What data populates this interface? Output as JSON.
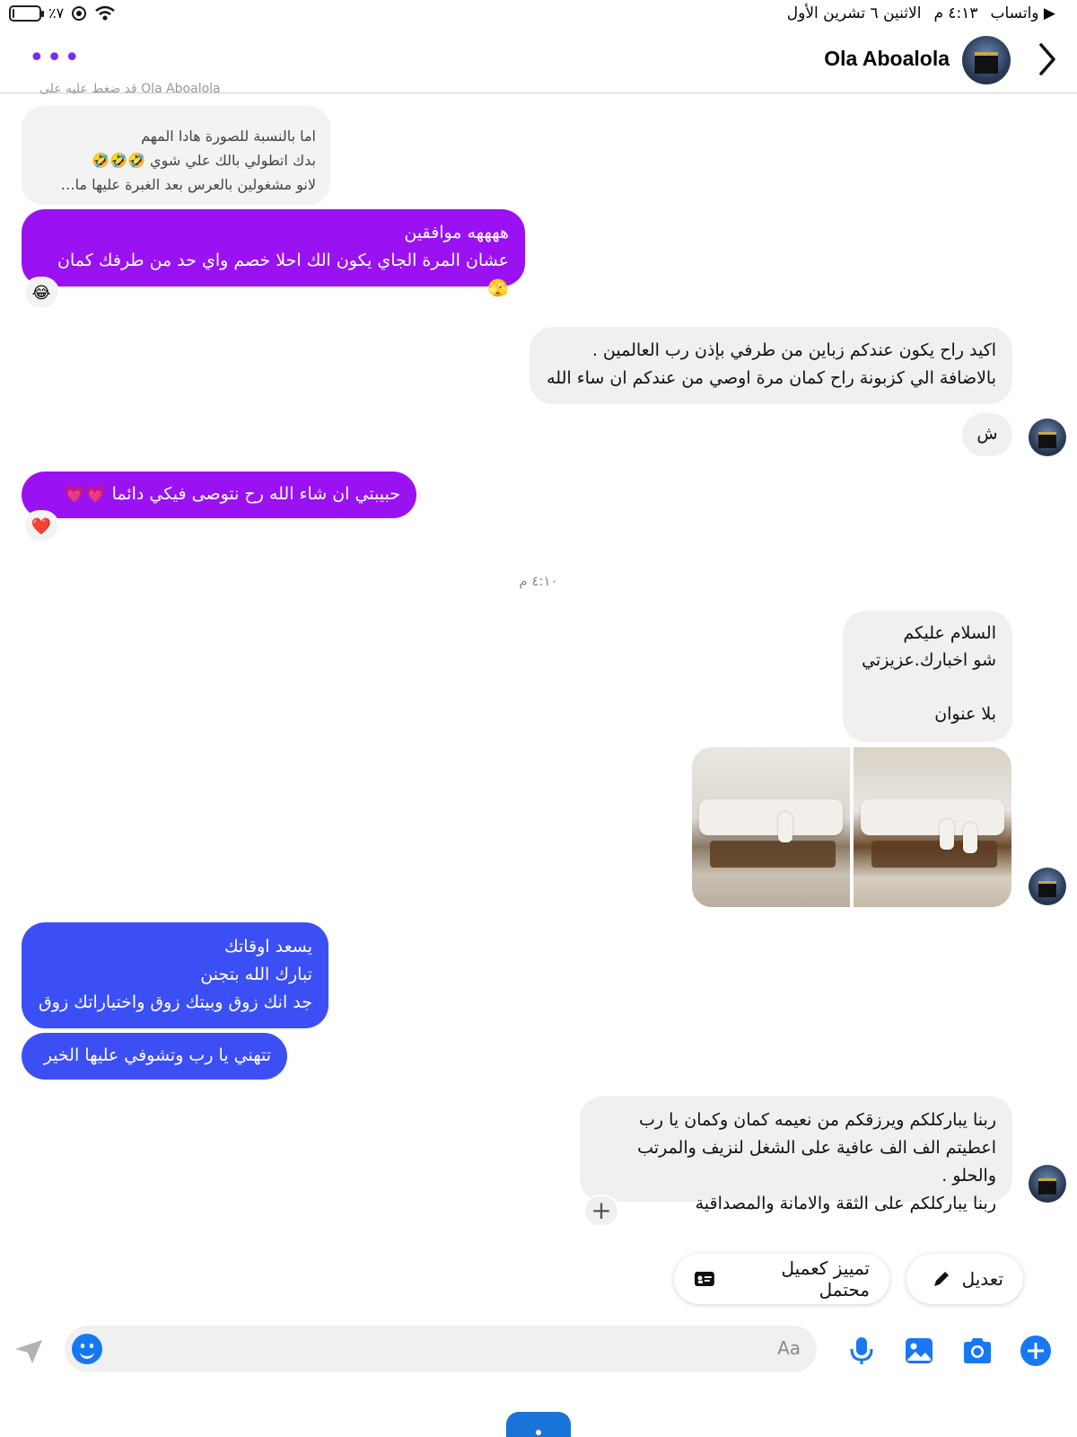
{
  "status_bar": {
    "carrier": "▶ واتساب",
    "time": "٤:١٣ م",
    "date": "الاثنين ٦ تشرين الأول",
    "battery": "٪٧",
    "battery_level": 0.07
  },
  "header": {
    "contact_name": "Ola Aboalola",
    "more_icon": "more-dots-icon",
    "back_icon": "chevron-icon"
  },
  "messages": {
    "reply_ref": "قد ضغط عليه على Ola Aboalola",
    "reply_preview": "اما بالنسبة للصورة هادا المهم\nبدك اتطولي بالك علي شوي 🤣🤣🤣\nلانو مشغولين بالعرس بعد الغبرة عليها ما…",
    "m1": "ههههه موافقين\nعشان المرة الجاي يكون الك احلا خصم واي حد من طرفك كمان 🫣",
    "m1_reaction": "😂",
    "m2": "اكيد راح يكون عندكم زباين من طرفي بإذن رب العالمين .\nبالاضافة الي كزبونة راح كمان مرة اوصي من عندكم ان ساء الله",
    "m3": "ش",
    "m4": "حبيبتي ان شاء الله رح نتوصى فيكي دائما 💗💗",
    "m4_reaction": "❤️",
    "timestamp": "٤:١٠ م",
    "m5": "السلام عليكم\nشو اخبارك.عزيزتي\n\nبلا عنوان",
    "m6": "يسعد اوقاتك\nتبارك الله بتجنن\nجد انك زوق وبيتك زوق واختياراتك زوق",
    "m7": "تتهني يا رب وتشوفي عليها الخير",
    "m8": "ربنا يباركلكم ويرزقكم من نعيمه كمان وكمان يا رب\nاعطيتم الف الف عافية على الشغل لنزيف والمرتب والحلو .\nربنا يباركلكم على الثقة والامانة والمصداقية",
    "add_reaction": "+"
  },
  "actions": {
    "edit_label": "تعديل",
    "mark_label": "تمييز كعميل محتمل"
  },
  "composer": {
    "placeholder": "Aa"
  },
  "colors": {
    "purple_bubble": "#9a12f2",
    "indigo_bubble": "#3b4ff5",
    "gray_bubble": "#f0f0f0",
    "accent": "#1877f2"
  }
}
